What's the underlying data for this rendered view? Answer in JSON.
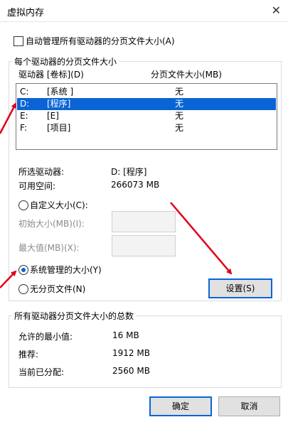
{
  "window": {
    "title": "虚拟内存",
    "close_glyph": "✕"
  },
  "auto_manage": {
    "label": "自动管理所有驱动器的分页文件大小(A)",
    "checked": false
  },
  "drives_group": {
    "title": "每个驱动器的分页文件大小",
    "col_drive": "驱动器 [卷标](D)",
    "col_size": "分页文件大小(MB)",
    "rows": [
      {
        "drive": "C:",
        "label": "[系统 ]",
        "size": "无",
        "selected": false
      },
      {
        "drive": "D:",
        "label": "[程序]",
        "size": "无",
        "selected": true
      },
      {
        "drive": "E:",
        "label": "[E]",
        "size": "无",
        "selected": false
      },
      {
        "drive": "F:",
        "label": "[项目]",
        "size": "无",
        "selected": false
      }
    ],
    "selected_label": "所选驱动器:",
    "selected_value": "D:  [程序]",
    "space_label": "可用空间:",
    "space_value": "266073 MB",
    "custom_label": "自定义大小(C):",
    "initial_label": "初始大小(MB)(I):",
    "max_label": "最大值(MB)(X):",
    "system_label": "系统管理的大小(Y)",
    "none_label": "无分页文件(N)",
    "set_button": "设置(S)"
  },
  "totals_group": {
    "title": "所有驱动器分页文件大小的总数",
    "min_label": "允许的最小值:",
    "min_value": "16 MB",
    "rec_label": "推荐:",
    "rec_value": "1912 MB",
    "cur_label": "当前已分配:",
    "cur_value": "2560 MB"
  },
  "buttons": {
    "ok": "确定",
    "cancel": "取消"
  },
  "colors": {
    "selection": "#0a64d6",
    "arrow": "#e0001b"
  }
}
